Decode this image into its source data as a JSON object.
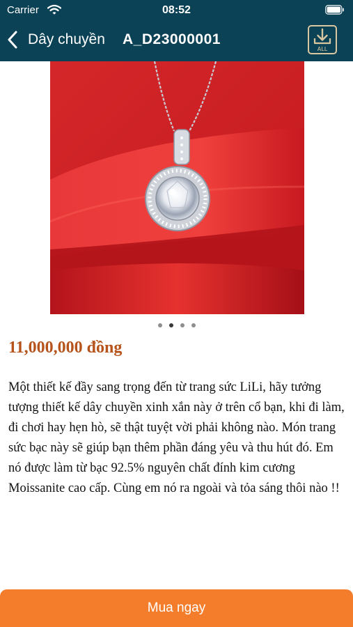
{
  "status_bar": {
    "carrier": "Carrier",
    "time": "08:52",
    "wifi_icon": "wifi-icon",
    "battery_icon": "battery-icon"
  },
  "nav_bar": {
    "back_icon": "chevron-left-icon",
    "category": "Dây chuyền",
    "product_code": "A_D23000001",
    "download_all_label": "ALL",
    "background_color": "#0c4256"
  },
  "carousel": {
    "page_count": 4,
    "active_index": 1
  },
  "product": {
    "price": "11,000,000 đồng",
    "price_color": "#b5531b",
    "description": "Một thiết kế đầy sang trọng đến từ trang sức LiLi, hãy tưởng tượng thiết kế dây chuyền xinh xắn này ở trên cổ bạn, khi đi làm, đi chơi hay hẹn hò, sẽ thật tuyệt vời phải không nào. Món trang sức bạc này sẽ giúp bạn thêm phần đáng yêu và thu hút đó. Em nó được làm từ bạc 92.5% nguyên chất đính kim cương Moissanite cao cấp. Cùng em nó ra ngoài và tỏa sáng thôi nào !!"
  },
  "actions": {
    "buy_now": "Mua ngay",
    "buy_color": "#f47d2c"
  }
}
